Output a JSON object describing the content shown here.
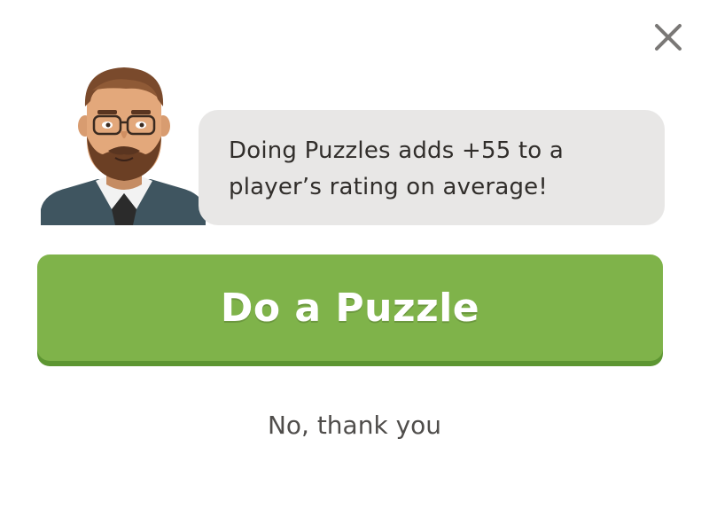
{
  "dialog": {
    "message": "Doing Puzzles adds +55 to a player’s rating on average!",
    "primary_button_label": "Do a Puzzle",
    "secondary_button_label": "No, thank you",
    "close_icon": "close-icon",
    "avatar_icon": "coach-avatar"
  },
  "colors": {
    "primary": "#7fb34a",
    "primary_shadow": "#5d9632",
    "bubble": "#e8e7e6",
    "text": "#312e2b",
    "muted_text": "#4f4d4b"
  }
}
